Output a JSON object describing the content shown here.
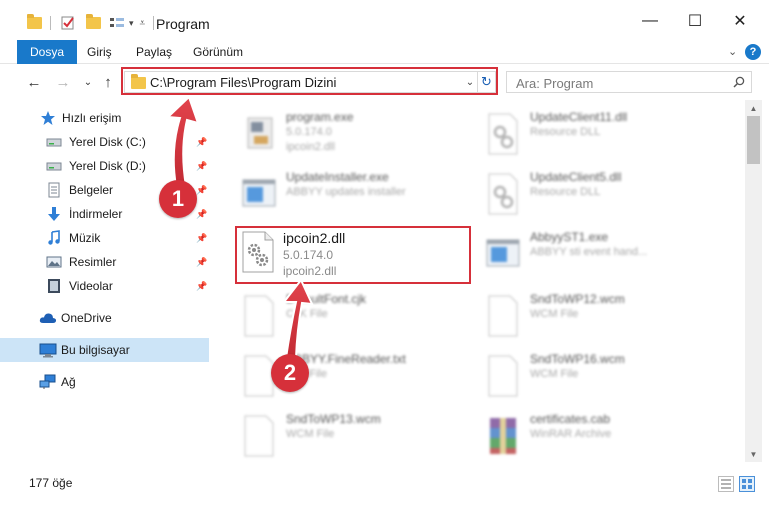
{
  "window": {
    "title": "Program",
    "minimize_glyph": "—",
    "maximize_glyph": "☐",
    "close_glyph": "✕"
  },
  "ribbon": {
    "tabs": [
      "Dosya",
      "Giriş",
      "Paylaş",
      "Görünüm"
    ],
    "active_tab": "Dosya",
    "help_glyph": "?",
    "collapse_glyph": "⌄"
  },
  "nav": {
    "back_glyph": "←",
    "forward_glyph": "→",
    "recent_glyph": "⌄",
    "up_glyph": "↑",
    "address": "C:\\Program Files\\Program Dizini",
    "search_placeholder": "Ara: Program"
  },
  "sidebar": {
    "items": [
      {
        "label": "Hızlı erişim",
        "icon": "star-icon",
        "pinned": false
      },
      {
        "label": "Yerel Disk (C:)",
        "icon": "drive-icon",
        "pinned": true
      },
      {
        "label": "Yerel Disk (D:)",
        "icon": "drive-icon",
        "pinned": true
      },
      {
        "label": "Belgeler",
        "icon": "document-icon",
        "pinned": true
      },
      {
        "label": "İndirmeler",
        "icon": "download-icon",
        "pinned": true
      },
      {
        "label": "Müzik",
        "icon": "music-icon",
        "pinned": true
      },
      {
        "label": "Resimler",
        "icon": "pictures-icon",
        "pinned": true
      },
      {
        "label": "Videolar",
        "icon": "video-icon",
        "pinned": true
      },
      {
        "label": "OneDrive",
        "icon": "cloud-icon",
        "pinned": false
      },
      {
        "label": "Bu bilgisayar",
        "icon": "computer-icon",
        "pinned": false
      },
      {
        "label": "Ağ",
        "icon": "network-icon",
        "pinned": false
      }
    ],
    "selected": "Bu bilgisayar",
    "pin_glyph": "📌"
  },
  "files": {
    "left": [
      {
        "name": "program.exe",
        "sub1": "5.0.174.0",
        "sub2": "ipcoin2.dll",
        "icon": "exe-icon"
      },
      {
        "name": "UpdateInstaller.exe",
        "sub1": "ABBYY updates installer",
        "sub2": "",
        "icon": "window-icon"
      },
      {
        "name": "ipcoin2.dll",
        "sub1": "5.0.174.0",
        "sub2": "ipcoin2.dll",
        "icon": "dll-gear-icon"
      },
      {
        "name": "DefaultFont.cjk",
        "sub1": "CJK File",
        "sub2": "",
        "icon": "blank-file-icon"
      },
      {
        "name": "ABBYY.FineReader.txt",
        "sub1": "Text File",
        "sub2": "",
        "icon": "blank-file-icon"
      },
      {
        "name": "SndToWP13.wcm",
        "sub1": "WCM File",
        "sub2": "",
        "icon": "blank-file-icon"
      }
    ],
    "right": [
      {
        "name": "UpdateClient11.dll",
        "sub1": "Resource DLL",
        "sub2": "",
        "icon": "dll-gear-icon"
      },
      {
        "name": "UpdateClient5.dll",
        "sub1": "Resource DLL",
        "sub2": "",
        "icon": "dll-gear-icon"
      },
      {
        "name": "AbbyyST1.exe",
        "sub1": "ABBYY sti event hand...",
        "sub2": "",
        "icon": "window-icon"
      },
      {
        "name": "SndToWP12.wcm",
        "sub1": "WCM File",
        "sub2": "",
        "icon": "blank-file-icon"
      },
      {
        "name": "SndToWP16.wcm",
        "sub1": "WCM File",
        "sub2": "",
        "icon": "blank-file-icon"
      },
      {
        "name": "certificates.cab",
        "sub1": "WinRAR Archive",
        "sub2": "",
        "icon": "archive-icon"
      }
    ]
  },
  "callouts": [
    "1",
    "2"
  ],
  "status": {
    "count": "177 öğe"
  },
  "colors": {
    "accent": "#1979ca",
    "highlight_red": "#d6303a",
    "selection": "#cce4f7"
  }
}
